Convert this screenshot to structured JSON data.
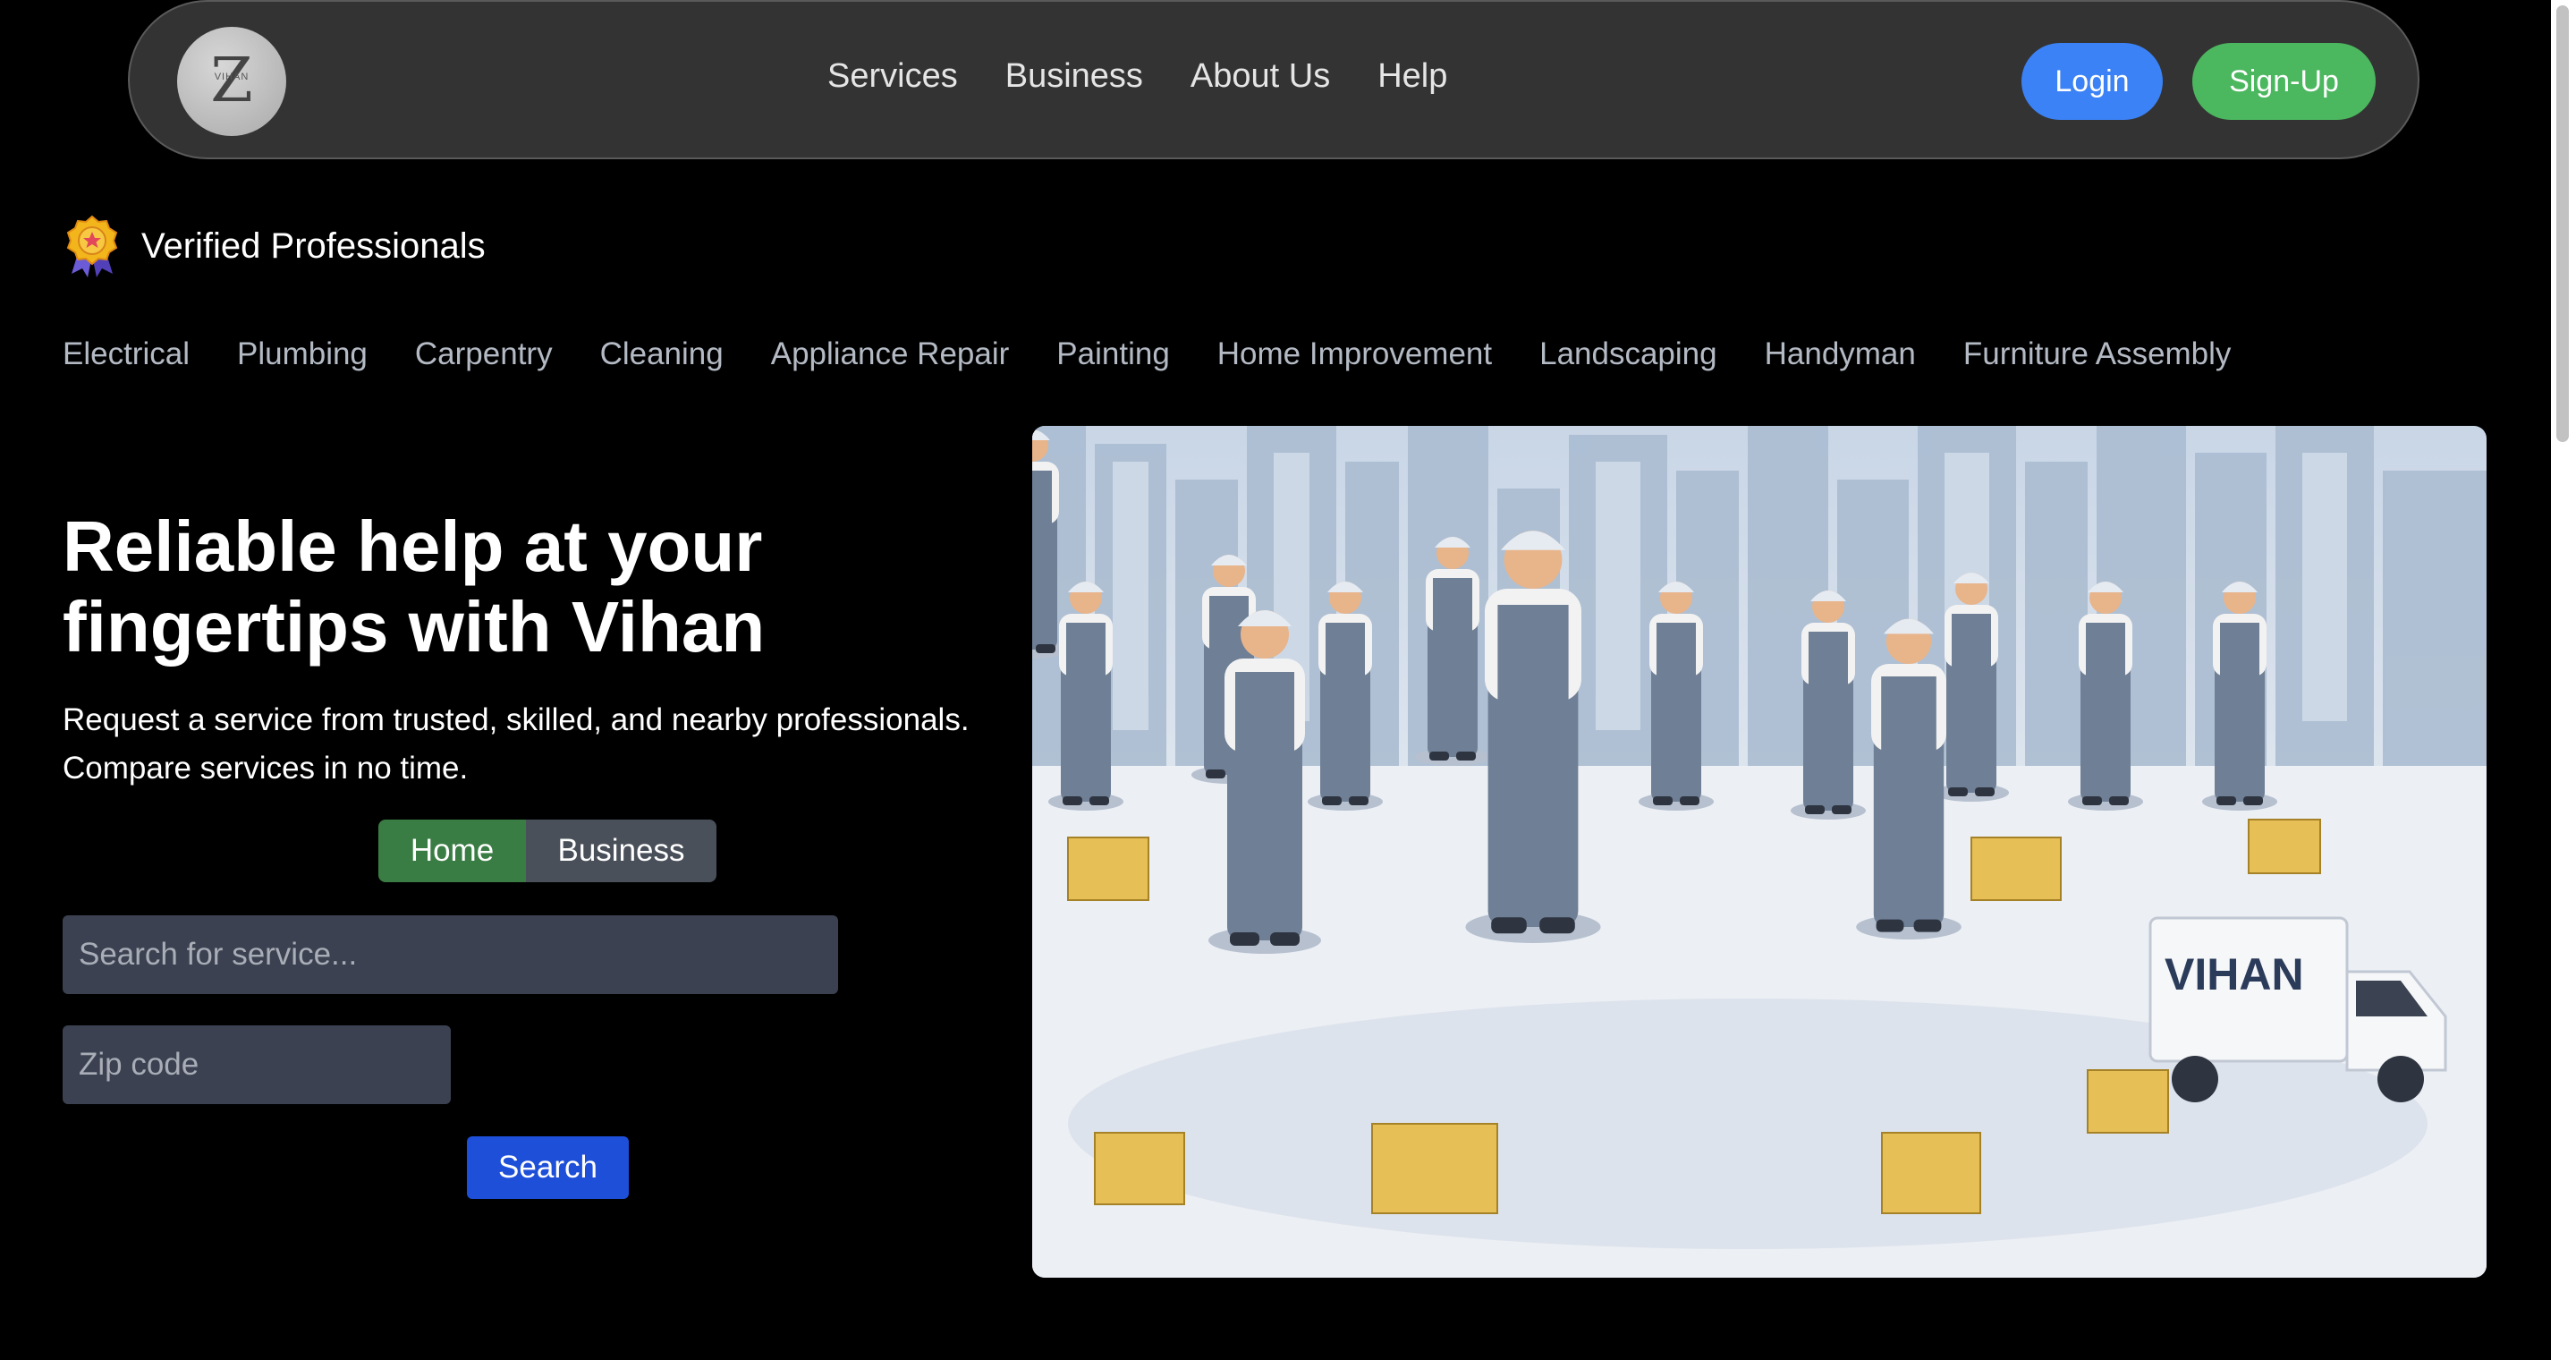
{
  "nav": {
    "logo_letter": "Z",
    "logo_small_text": "VIHAN",
    "links": [
      "Services",
      "Business",
      "About Us",
      "Help"
    ],
    "login_label": "Login",
    "signup_label": "Sign-Up"
  },
  "verified": {
    "label": "Verified Professionals"
  },
  "categories": [
    "Electrical",
    "Plumbing",
    "Carpentry",
    "Cleaning",
    "Appliance Repair",
    "Painting",
    "Home Improvement",
    "Landscaping",
    "Handyman",
    "Furniture Assembly"
  ],
  "hero": {
    "headline": "Reliable help at your fingertips with Vihan",
    "subtext_line1": "Request a service from trusted, skilled, and nearby professionals.",
    "subtext_line2": "Compare services in no time.",
    "toggle_home": "Home",
    "toggle_business": "Business",
    "search_placeholder": "Search for service...",
    "zip_placeholder": "Zip code",
    "search_button": "Search",
    "truck_text": "VIHAN"
  },
  "colors": {
    "login": "#3b82f6",
    "signup": "#4bb75f",
    "toggle_active": "#3a7d44",
    "search_button": "#1d4fd8"
  }
}
